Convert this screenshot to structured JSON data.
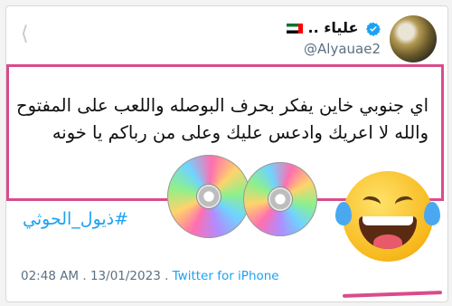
{
  "tweet": {
    "display_name": "علياء ..",
    "handle": "@Alyauae2",
    "text": "اي جنوبي خاين يفكر بحرف البوصله واللعب على المفتوح والله لا اعريك وادعس عليك وعلى من رباكم يا خونه",
    "hashtag": "#ذيول_الحوثي",
    "time": "02:48 AM",
    "date": "13/01/2023",
    "separator": " . ",
    "source": "Twitter for iPhone"
  },
  "colors": {
    "highlight": "#d84c8c",
    "link": "#1da1f2",
    "verified": "#1da1f2"
  },
  "icons": [
    "verified-badge-icon",
    "uae-flag-icon",
    "share-icon",
    "disc-icon",
    "laughing-tears-emoji-icon"
  ]
}
